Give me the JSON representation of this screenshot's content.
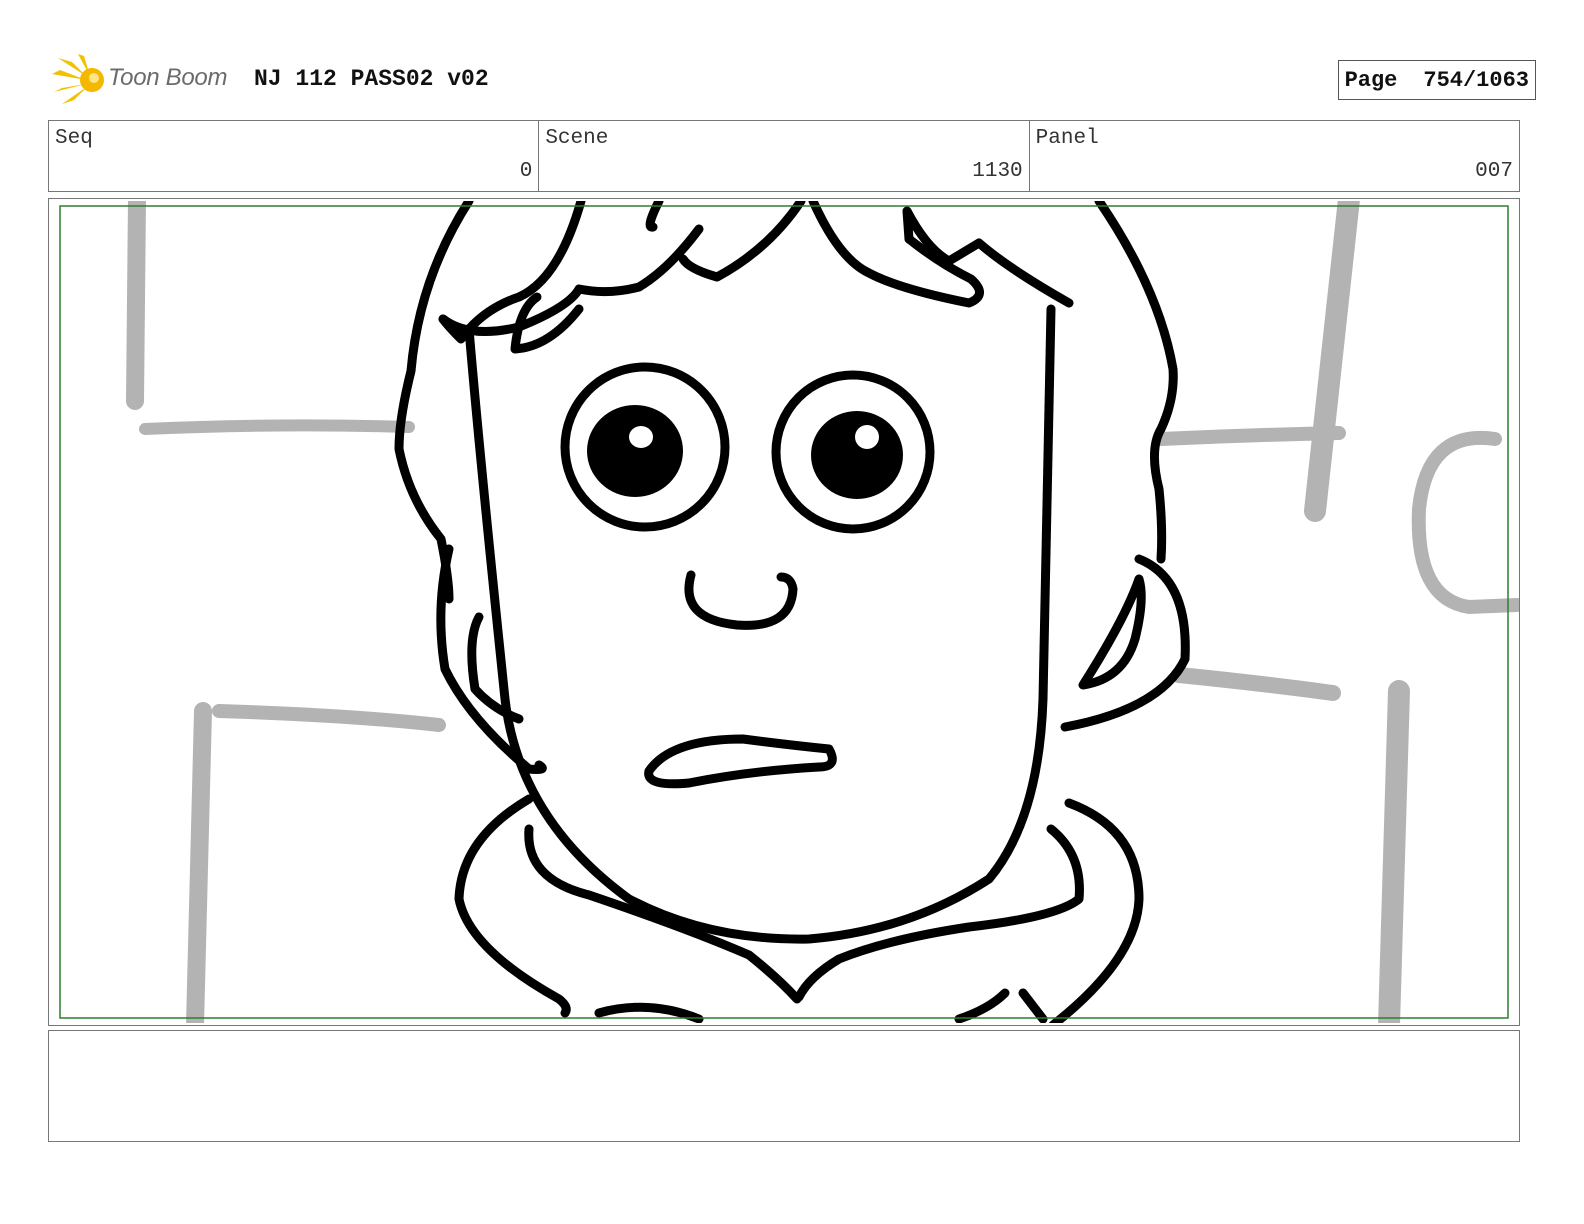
{
  "header": {
    "logo_text": "Toon Boom",
    "document_title": "NJ 112 PASS02 v02",
    "page_label": "Page",
    "page_value": "754/1063"
  },
  "info": {
    "seq_label": "Seq",
    "seq_value": "0",
    "scene_label": "Scene",
    "scene_value": "1130",
    "panel_label": "Panel",
    "panel_value": "007"
  },
  "colors": {
    "safe_frame": "#2e7d2e",
    "ink": "#000000",
    "background_strokes": "#b3b3b3",
    "logo_star": "#f2c200"
  },
  "icons": {
    "logo": "toon-boom-star-icon"
  },
  "notes": ""
}
